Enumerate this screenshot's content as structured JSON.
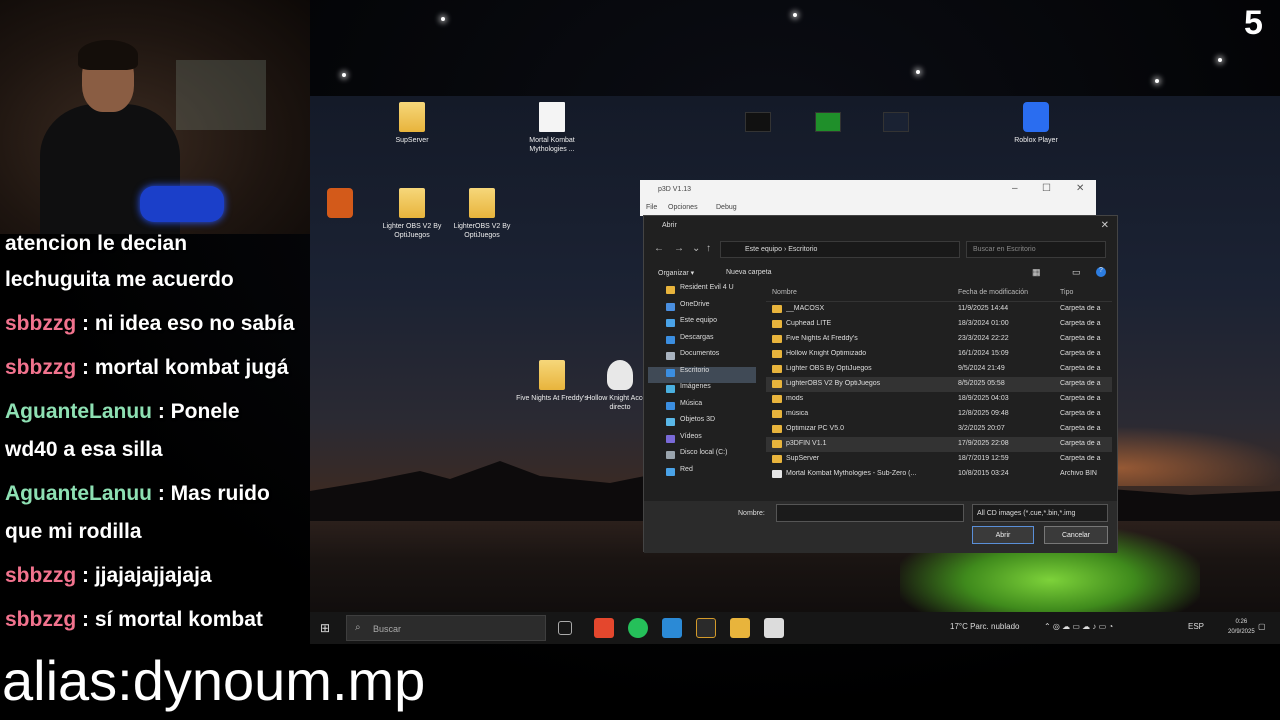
{
  "overlay": {
    "counter": "5",
    "alias": "alias:dynoum.mp"
  },
  "chat": [
    {
      "user": "",
      "text": "atencion le decian",
      "color": "#ffffff"
    },
    {
      "user": "",
      "text": "lechuguita me acuerdo",
      "color": "#ffffff"
    },
    {
      "user": "sbbzzg",
      "text": " : ni idea eso no sabía",
      "color": "#f2738e"
    },
    {
      "user": "sbbzzg",
      "text": " : mortal kombat jugá",
      "color": "#f2738e"
    },
    {
      "user": "AguanteLanuu",
      "text": " : Ponele",
      "color": "#8ee0b3"
    },
    {
      "user": "",
      "text": "wd40 a esa silla",
      "color": "#ffffff"
    },
    {
      "user": "AguanteLanuu",
      "text": " : Mas ruido",
      "color": "#8ee0b3"
    },
    {
      "user": "",
      "text": "que mi rodilla",
      "color": "#ffffff"
    },
    {
      "user": "sbbzzg",
      "text": " : jjajajajjajaja",
      "color": "#f2738e"
    },
    {
      "user": "sbbzzg",
      "text": " : sí mortal kombat",
      "color": "#f2738e"
    }
  ],
  "desktop_icons": [
    {
      "label": "SupServer",
      "kind": "folder"
    },
    {
      "label": "Mortal Kombat Mythologies ...",
      "kind": "doc"
    },
    {
      "label": "Lighter OBS V2 By OptiJuegos",
      "kind": "folder"
    },
    {
      "label": "LighterOBS V2 By OptiJuegos",
      "kind": "folder"
    },
    {
      "label": "Five Nights At Freddy's",
      "kind": "folder"
    },
    {
      "label": "Hollow Knight Acceso directo",
      "kind": "app"
    },
    {
      "label": "Roblox Player",
      "kind": "app"
    }
  ],
  "bg_window": {
    "title": "p3D V1.13",
    "menu": [
      "File",
      "Opciones",
      "Debug"
    ]
  },
  "dialog": {
    "title": "Abrir",
    "breadcrumb": [
      "Este equipo",
      "Escritorio"
    ],
    "search_placeholder": "Buscar en Escritorio",
    "organize": "Organizar ▾",
    "new_folder": "Nueva carpeta",
    "sidebar": [
      "Resident Evil 4 U",
      "OneDrive",
      "Este equipo",
      "Descargas",
      "Documentos",
      "Escritorio",
      "Imágenes",
      "Música",
      "Objetos 3D",
      "Vídeos",
      "Disco local (C:)",
      "Red"
    ],
    "columns": {
      "name": "Nombre",
      "date": "Fecha de modificación",
      "type": "Tipo"
    },
    "files": [
      {
        "name": "__MACOSX",
        "date": "11/9/2025 14:44",
        "type": "Carpeta de a"
      },
      {
        "name": "Cuphead LITE",
        "date": "18/3/2024 01:00",
        "type": "Carpeta de a"
      },
      {
        "name": "Five Nights At Freddy's",
        "date": "23/3/2024 22:22",
        "type": "Carpeta de a"
      },
      {
        "name": "Hollow Knight Optimizado",
        "date": "16/1/2024 15:09",
        "type": "Carpeta de a"
      },
      {
        "name": "Lighter OBS By OptiJuegos",
        "date": "9/5/2024 21:49",
        "type": "Carpeta de a"
      },
      {
        "name": "LighterOBS V2 By OptiJuegos",
        "date": "8/5/2025 05:58",
        "type": "Carpeta de a"
      },
      {
        "name": "mods",
        "date": "18/9/2025 04:03",
        "type": "Carpeta de a"
      },
      {
        "name": "música",
        "date": "12/8/2025 09:48",
        "type": "Carpeta de a"
      },
      {
        "name": "Optimizar PC V5.0",
        "date": "3/2/2025 20:07",
        "type": "Carpeta de a"
      },
      {
        "name": "p3DFIN V1.1",
        "date": "17/9/2025 22:08",
        "type": "Carpeta de a"
      },
      {
        "name": "SupServer",
        "date": "18/7/2019 12:59",
        "type": "Carpeta de a"
      },
      {
        "name": "Mortal Kombat Mythologies - Sub-Zero (...",
        "date": "10/8/2015 03:24",
        "type": "Archivo BIN"
      }
    ],
    "filename_label": "Nombre:",
    "filter": "All CD images (*.cue,*.bin,*.img",
    "open_button": "Abrir",
    "cancel_button": "Cancelar"
  },
  "taskbar": {
    "search_placeholder": "Buscar",
    "weather": "17°C  Parc. nublado",
    "language": "ESP",
    "time": "0:26",
    "date": "20/9/2025"
  }
}
